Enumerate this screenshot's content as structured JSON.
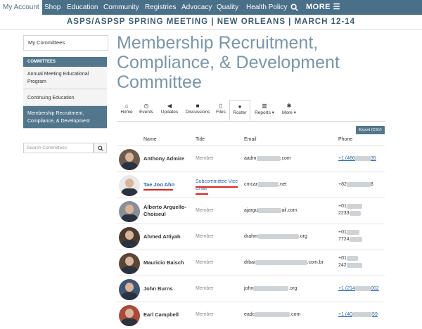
{
  "nav": {
    "items": [
      "My Account",
      "Shop",
      "Education",
      "Community",
      "Registries",
      "Advocacy",
      "Quality",
      "Health Policy"
    ],
    "more": "MORE"
  },
  "banner": "ASPS/ASPSP SPRING MEETING | NEW ORLEANS | MARCH 12-14",
  "sidebar": {
    "my_committees": "My Committees",
    "committees_head": "COMMITTEES",
    "items": [
      "Annual Meeting Educational Program",
      "Continuing Education",
      "Membership Recruitment, Compliance, & Development"
    ],
    "search_placeholder": "Search Committees"
  },
  "page_title": "Membership Recruitment, Compliance, & Development Committee",
  "tabs": [
    {
      "label": "Home",
      "icon": "home-icon"
    },
    {
      "label": "Events",
      "icon": "clock-icon"
    },
    {
      "label": "Updates",
      "icon": "megaphone-icon"
    },
    {
      "label": "Discussions",
      "icon": "comment-icon"
    },
    {
      "label": "Files",
      "icon": "file-icon"
    },
    {
      "label": "Roster",
      "icon": "user-icon"
    },
    {
      "label": "Reports ▾",
      "icon": "bar-chart-icon"
    },
    {
      "label": "More ▾",
      "icon": "asterisk-icon"
    }
  ],
  "export_label": "Export (CSV)",
  "table": {
    "headers": {
      "name": "Name",
      "title": "Title",
      "email": "Email",
      "phone": "Phone"
    },
    "rows": [
      {
        "name": "Anthony Admire",
        "title": "Member",
        "email_start": "aadm",
        "email_end": ".com",
        "phone_start": "+1 (480",
        "phone_end": "35",
        "phone2": "",
        "phone_link": true
      },
      {
        "name": "Tae Joo Ahn",
        "title": "Subcommittee Vice Chair",
        "email_start": "cmcar",
        "email_end": ".net",
        "phone_start": "+82",
        "phone_end": "8",
        "phone2": "",
        "phone_link": false
      },
      {
        "name": "Alberto Arguello-Choiseul",
        "title": "Member",
        "email_start": "ajargu",
        "email_end": "ail.com",
        "phone_start": "+01",
        "phone_end": "",
        "phone2": "2233",
        "phone_link": false
      },
      {
        "name": "Ahmed Attiyah",
        "title": "Member",
        "email_start": "drahm",
        "email_end": ".org",
        "phone_start": "+01",
        "phone_end": "",
        "phone2": "7724",
        "phone_link": false
      },
      {
        "name": "Mauricio Baisch",
        "title": "Member",
        "email_start": "drbai",
        "email_end": ".com.br",
        "phone_start": "+01",
        "phone_end": "",
        "phone2": "242",
        "phone_link": false
      },
      {
        "name": "John Burns",
        "title": "Member",
        "email_start": "john",
        "email_end": ".org",
        "phone_start": "+1 (214",
        "phone_end": "002",
        "phone2": "",
        "phone_link": true
      },
      {
        "name": "Earl Campbell",
        "title": "Member",
        "email_start": "eadc",
        "email_end": ".com",
        "phone_start": "+1 (40",
        "phone_end": "59",
        "phone2": "",
        "phone_link": true
      }
    ]
  },
  "colors": {
    "nav_bg": "#4a6f88",
    "accent": "#52768c",
    "title_color": "#7a95a8",
    "link": "#2a64a8",
    "annotation": "#dd2222"
  }
}
